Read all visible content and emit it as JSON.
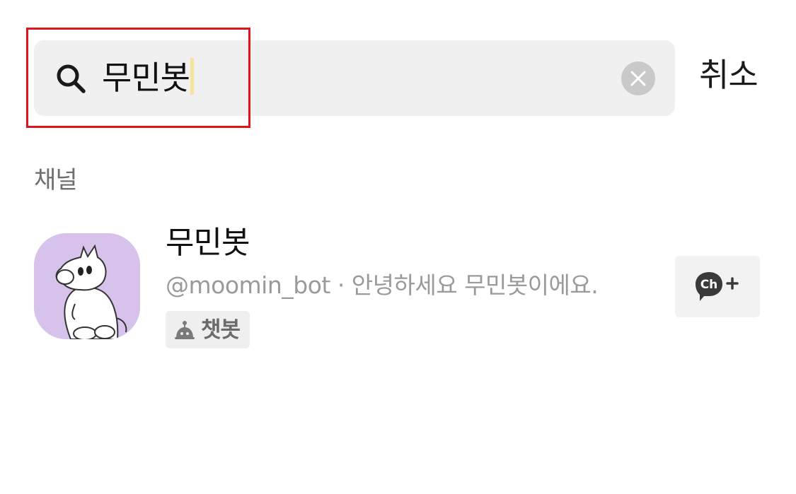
{
  "search": {
    "query": "무민봇",
    "icon": "search-icon",
    "clear_icon": "close-icon"
  },
  "header": {
    "cancel_label": "취소"
  },
  "sections": {
    "channel_title": "채널"
  },
  "channel": {
    "name": "무민봇",
    "description": "@moomin_bot · 안녕하세요 무민봇이에요.",
    "badge_label": "챗봇",
    "badge_icon": "bot-icon",
    "add_icon": "channel-add-icon",
    "add_icon_text": "Ch"
  },
  "colors": {
    "highlight": "#e0151c",
    "avatar_bg": "#d6c2ea",
    "search_bg": "#f0f0f0"
  }
}
